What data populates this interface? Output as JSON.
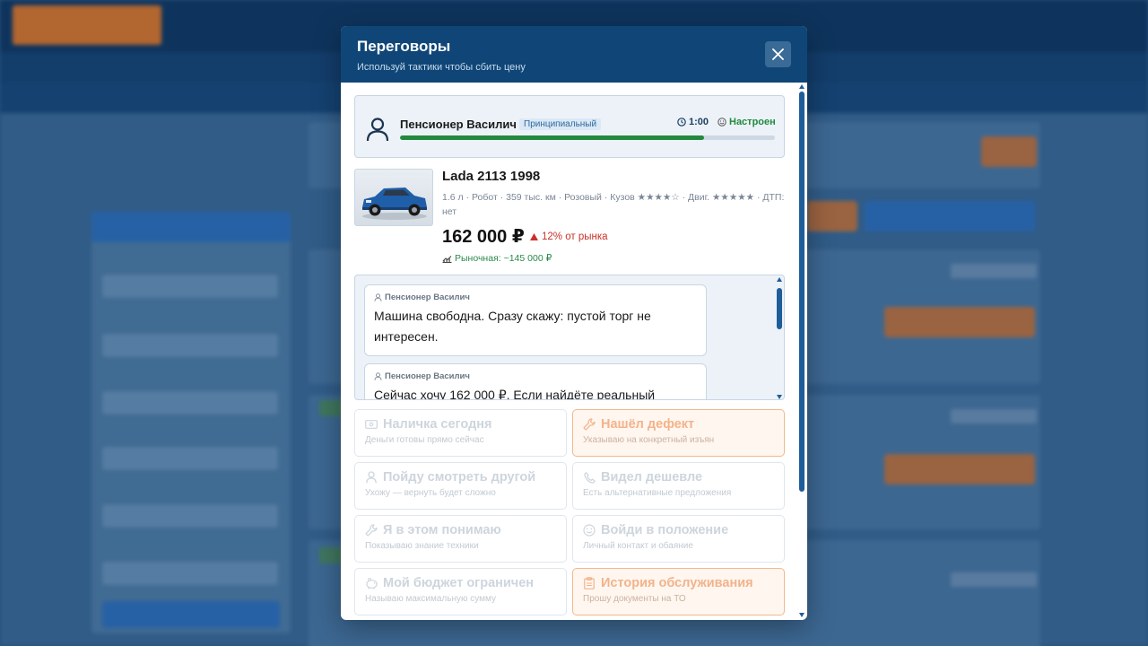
{
  "modal": {
    "title": "Переговоры",
    "subtitle": "Используй тактики чтобы сбить цену"
  },
  "seller": {
    "name": "Пенсионер Василич",
    "trait": "Принципиальный",
    "timer": "1:00",
    "mood": "Настроен",
    "mood_level": 0.81
  },
  "car": {
    "title": "Lada 2113 1998",
    "specs": "1.6 л · Робот · 359 тыс. км · Розовый · Кузов ★★★★☆ · Двиг. ★★★★★ · ДТП: нет",
    "price": "162 000 ₽",
    "delta": "12% от рынка",
    "market": "Рыночная: ~145 000 ₽"
  },
  "chat": {
    "messages": [
      {
        "author": "Пенсионер Василич",
        "text": "Машина свободна. Сразу скажу: пустой торг не интересен."
      },
      {
        "author": "Пенсионер Василич",
        "text": "Сейчас хочу 162 000 ₽. Если найдёте реальный"
      }
    ]
  },
  "tactics": [
    {
      "title": "Наличка сегодня",
      "desc": "Деньги готовы прямо сейчас",
      "icon": "cash-icon",
      "highlighted": false
    },
    {
      "title": "Нашёл дефект",
      "desc": "Указываю на конкретный изъян",
      "icon": "wrench-icon",
      "highlighted": true
    },
    {
      "title": "Пойду смотреть другой",
      "desc": "Ухожу — вернуть будет сложно",
      "icon": "user-icon",
      "highlighted": false
    },
    {
      "title": "Видел дешевле",
      "desc": "Есть альтернативные предложения",
      "icon": "phone-icon",
      "highlighted": false
    },
    {
      "title": "Я в этом понимаю",
      "desc": "Показываю знание техники",
      "icon": "wrench-icon",
      "highlighted": false
    },
    {
      "title": "Войди в положение",
      "desc": "Личный контакт и обаяние",
      "icon": "smile-icon",
      "highlighted": false
    },
    {
      "title": "Мой бюджет ограничен",
      "desc": "Называю максимальную сумму",
      "icon": "piggy-bank-icon",
      "highlighted": false
    },
    {
      "title": "История обслуживания",
      "desc": "Прошу документы на ТО",
      "icon": "clipboard-icon",
      "highlighted": true
    }
  ],
  "colors": {
    "header": "#0f4677",
    "accent_green": "#23893f",
    "accent_red": "#c8322b",
    "highlight_border": "#f2b98c"
  }
}
